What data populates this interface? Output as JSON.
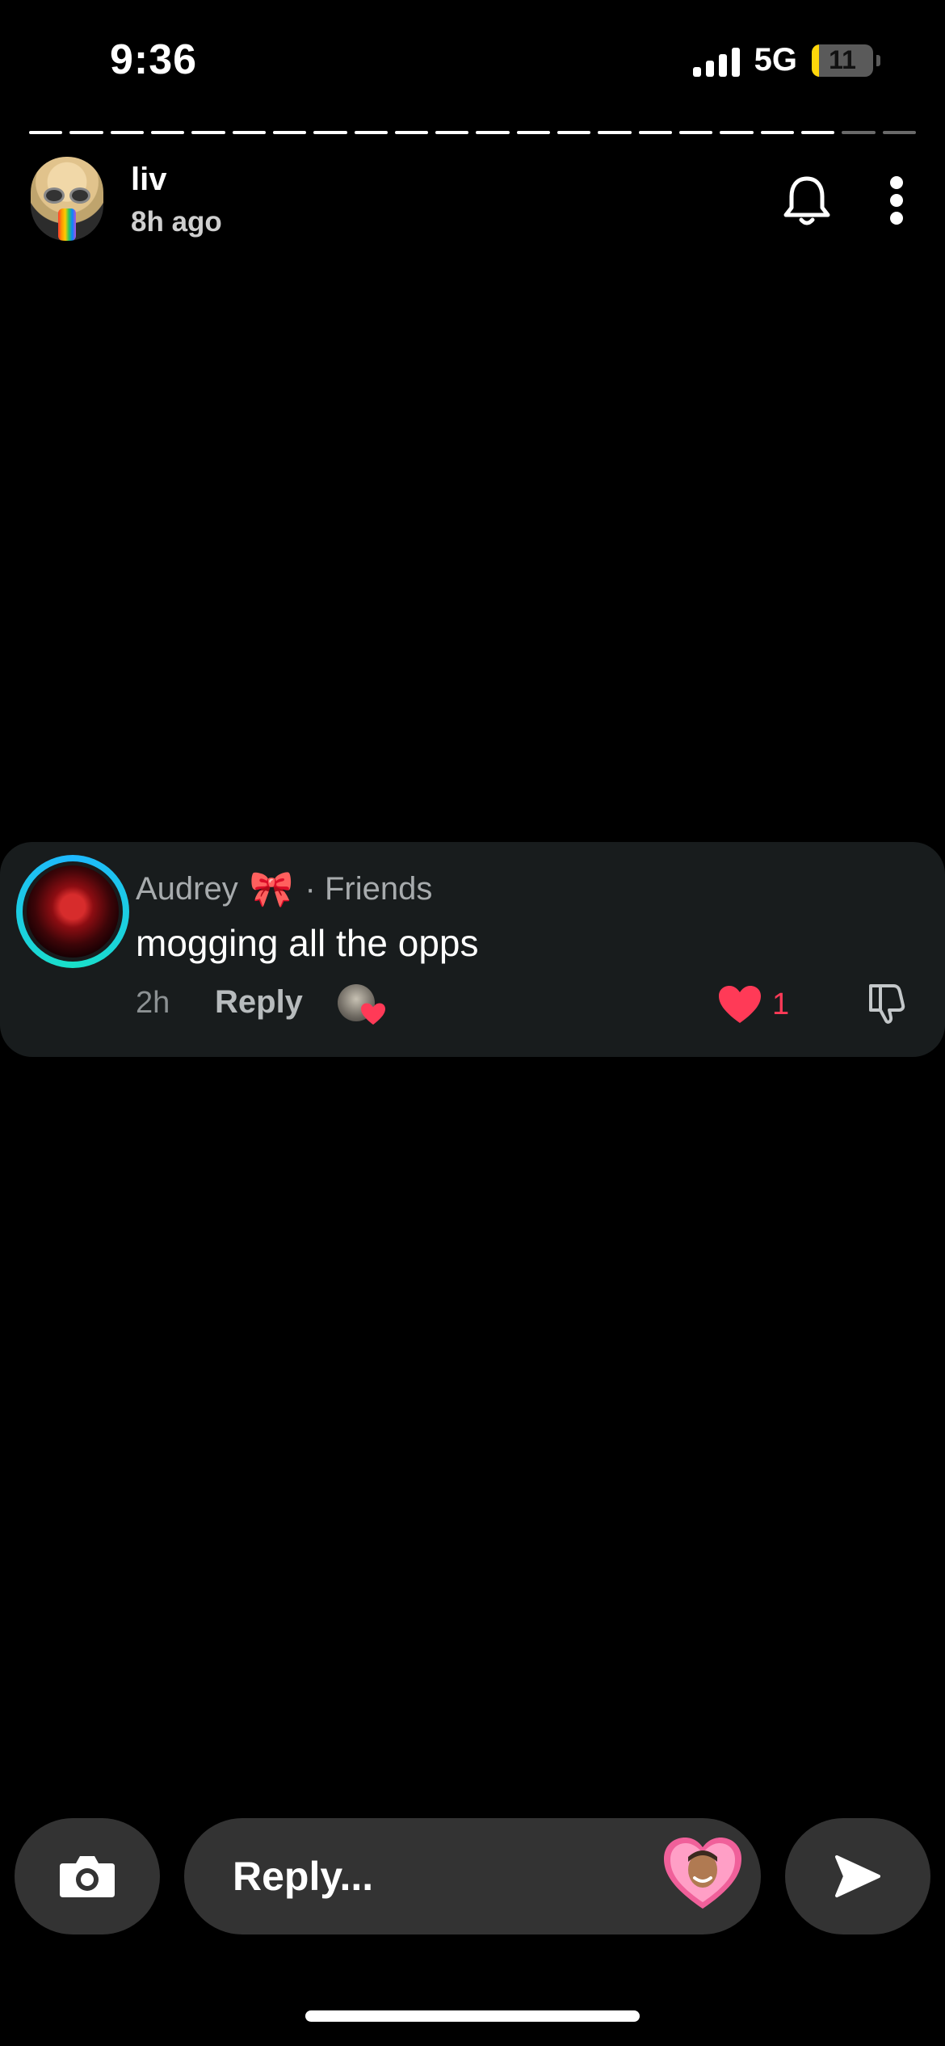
{
  "status_bar": {
    "time": "9:36",
    "network": "5G",
    "battery": "11"
  },
  "story": {
    "username": "liv",
    "posted": "8h ago",
    "segments_total": 22,
    "segments_viewed": 20
  },
  "comment": {
    "author": "Audrey",
    "author_emoji": "🎀",
    "relationship": "· Friends",
    "text": "mogging all the opps",
    "age": "2h",
    "reply_label": "Reply",
    "like_count": "1"
  },
  "composer": {
    "placeholder": "Reply..."
  },
  "colors": {
    "like": "#ff3a57",
    "ring": "#1fb8ff",
    "card": "#181c1d",
    "pill": "#333333"
  },
  "icons": [
    "bell-icon",
    "more-icon",
    "heart-icon",
    "thumbs-down-icon",
    "camera-icon",
    "send-icon"
  ]
}
